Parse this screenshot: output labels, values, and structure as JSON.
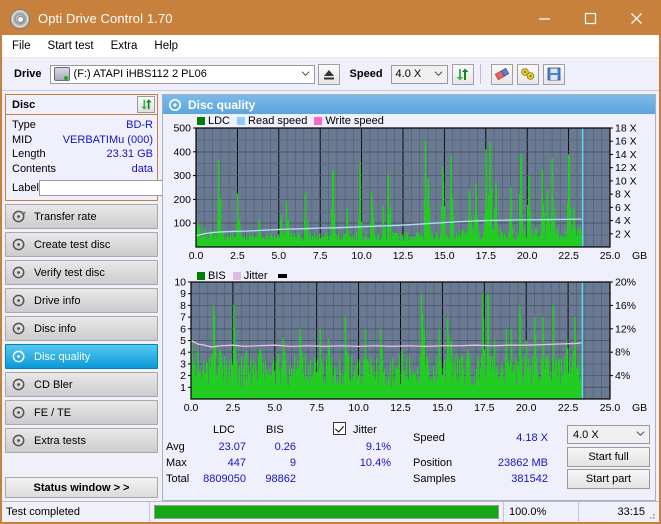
{
  "window": {
    "title": "Opti Drive Control 1.70",
    "icon": "disc-icon",
    "minimize": "minimize-icon",
    "maximize": "maximize-icon",
    "close": "close-icon",
    "accent_color": "#c8813c"
  },
  "menu": {
    "items": [
      "File",
      "Start test",
      "Extra",
      "Help"
    ]
  },
  "toolbar": {
    "drive_label": "Drive",
    "drive_value": "(F:)  ATAPI iHBS112  2 PL06",
    "eject_icon": "eject-icon",
    "speed_label": "Speed",
    "speed_value": "4.0 X",
    "refresh_icon": "refresh-icon",
    "eraser_icon": "eraser-icon",
    "config_icon": "wrench-icon",
    "save_icon": "save-icon"
  },
  "disc_panel": {
    "title": "Disc",
    "refresh_icon": "refresh-icon",
    "rows": [
      {
        "key": "Type",
        "value": "BD-R"
      },
      {
        "key": "MID",
        "value": "VERBATIMu (000)"
      },
      {
        "key": "Length",
        "value": "23.31 GB"
      },
      {
        "key": "Contents",
        "value": "data"
      }
    ],
    "label_key": "Label",
    "label_value": "",
    "label_placeholder": "",
    "label_button_icon": "cd-icon"
  },
  "sidebar": {
    "items": [
      {
        "label": "Transfer rate",
        "icon": "disc-rate-icon",
        "selected": false
      },
      {
        "label": "Create test disc",
        "icon": "disc-create-icon",
        "selected": false
      },
      {
        "label": "Verify test disc",
        "icon": "disc-verify-icon",
        "selected": false
      },
      {
        "label": "Drive info",
        "icon": "disc-drive-icon",
        "selected": false
      },
      {
        "label": "Disc info",
        "icon": "disc-info-icon",
        "selected": false
      },
      {
        "label": "Disc quality",
        "icon": "disc-quality-icon",
        "selected": true
      },
      {
        "label": "CD Bler",
        "icon": "disc-bler-icon",
        "selected": false
      },
      {
        "label": "FE / TE",
        "icon": "disc-fete-icon",
        "selected": false
      },
      {
        "label": "Extra tests",
        "icon": "disc-extra-icon",
        "selected": false
      }
    ],
    "status_window_button": "Status window > >"
  },
  "panel": {
    "header_title": "Disc quality",
    "header_icon": "disc-quality-icon"
  },
  "chart_data": [
    {
      "type": "area",
      "name": "ldc-chart",
      "title": "",
      "xlabel": "GB",
      "ylabel": "",
      "xlim": [
        0.0,
        25.0
      ],
      "ylim": [
        0,
        500
      ],
      "xticks": [
        "0.0",
        "2.5",
        "5.0",
        "7.5",
        "10.0",
        "12.5",
        "15.0",
        "17.5",
        "20.0",
        "22.5",
        "25.0"
      ],
      "yticks": [
        "100",
        "200",
        "300",
        "400",
        "500"
      ],
      "y2ticks": [
        "2 X",
        "4 X",
        "6 X",
        "8 X",
        "10 X",
        "12 X",
        "14 X",
        "16 X",
        "18 X"
      ],
      "y2lim": [
        0,
        18
      ],
      "grid": true,
      "legend": [
        {
          "label": "LDC",
          "color": "#008000"
        },
        {
          "label": "Read speed",
          "color": "#87cefa"
        },
        {
          "label": "Write speed",
          "color": "#ff66cc"
        }
      ],
      "series": [
        {
          "name": "LDC",
          "color": "#22cc22",
          "x_end_gb": 23.35,
          "baseline": [
            60,
            62,
            58,
            55,
            53,
            52,
            50,
            48,
            47,
            46,
            45,
            46,
            44,
            43,
            45,
            44,
            42,
            43,
            44,
            45,
            46,
            44,
            43,
            45,
            46,
            44,
            45,
            43,
            42,
            44,
            45,
            46,
            44,
            45,
            46,
            45,
            44,
            46,
            47,
            45,
            44,
            46,
            45,
            47,
            46,
            45,
            44,
            46,
            48,
            47,
            46,
            45,
            47,
            46,
            48,
            47,
            49,
            48,
            47,
            49,
            50,
            48,
            49,
            51,
            50,
            52,
            51,
            50,
            52,
            53,
            52,
            54,
            53,
            52,
            54,
            55,
            54,
            56,
            55,
            54,
            56,
            57,
            56,
            58,
            57,
            56,
            58,
            59,
            58,
            60,
            59,
            58,
            60,
            61,
            60,
            62,
            61,
            63,
            62,
            61
          ],
          "spikes": [
            {
              "x": 0.1,
              "y": 105
            },
            {
              "x": 1.35,
              "y": 370
            },
            {
              "x": 2.5,
              "y": 225
            },
            {
              "x": 2.55,
              "y": 120
            },
            {
              "x": 3.8,
              "y": 118
            },
            {
              "x": 5.1,
              "y": 135
            },
            {
              "x": 5.45,
              "y": 195
            },
            {
              "x": 6.6,
              "y": 230
            },
            {
              "x": 8.25,
              "y": 325
            },
            {
              "x": 9.1,
              "y": 168
            },
            {
              "x": 9.9,
              "y": 355
            },
            {
              "x": 10.6,
              "y": 232
            },
            {
              "x": 11.3,
              "y": 172
            },
            {
              "x": 11.6,
              "y": 305
            },
            {
              "x": 13.85,
              "y": 447
            },
            {
              "x": 14.0,
              "y": 290
            },
            {
              "x": 14.9,
              "y": 340
            },
            {
              "x": 15.4,
              "y": 385
            },
            {
              "x": 16.5,
              "y": 240
            },
            {
              "x": 16.9,
              "y": 270
            },
            {
              "x": 17.5,
              "y": 410
            },
            {
              "x": 17.75,
              "y": 443
            },
            {
              "x": 18.1,
              "y": 275
            },
            {
              "x": 19.0,
              "y": 250
            },
            {
              "x": 19.6,
              "y": 390
            },
            {
              "x": 20.1,
              "y": 300
            },
            {
              "x": 20.9,
              "y": 325
            },
            {
              "x": 21.2,
              "y": 240
            },
            {
              "x": 21.5,
              "y": 373
            },
            {
              "x": 22.5,
              "y": 390
            },
            {
              "x": 22.8,
              "y": 170
            }
          ]
        },
        {
          "name": "Read speed",
          "color": "#b0e0f8",
          "points_x": [
            0.0,
            0.5,
            1.0,
            1.6,
            2.2,
            3.0,
            3.8,
            4.6,
            5.4,
            6.4,
            7.4,
            8.4,
            9.4,
            10.4,
            11.4,
            12.4,
            13.4,
            14.4,
            15.4,
            16.4,
            17.4,
            18.4,
            19.4,
            20.4,
            21.4,
            22.4,
            23.3
          ],
          "points_y_speed": [
            1.7,
            2.0,
            2.2,
            2.3,
            2.35,
            2.4,
            2.5,
            2.6,
            2.7,
            2.75,
            2.85,
            2.9,
            3.0,
            3.1,
            3.2,
            3.3,
            3.45,
            3.6,
            3.75,
            3.9,
            4.0,
            4.05,
            4.1,
            4.12,
            4.15,
            4.18,
            4.2
          ]
        }
      ],
      "cursor_x_gb": 23.35
    },
    {
      "type": "area",
      "name": "bis-chart",
      "title": "",
      "xlabel": "GB",
      "ylabel": "",
      "xlim": [
        0.0,
        25.0
      ],
      "ylim": [
        0,
        10
      ],
      "xticks": [
        "0.0",
        "2.5",
        "5.0",
        "7.5",
        "10.0",
        "12.5",
        "15.0",
        "17.5",
        "20.0",
        "22.5",
        "25.0"
      ],
      "yticks": [
        "1",
        "2",
        "3",
        "4",
        "5",
        "6",
        "7",
        "8",
        "9",
        "10"
      ],
      "y2ticks": [
        "4%",
        "8%",
        "12%",
        "16%",
        "20%"
      ],
      "y2lim": [
        0,
        20
      ],
      "grid": true,
      "legend": [
        {
          "label": "BIS",
          "color": "#008000"
        },
        {
          "label": "Jitter",
          "color": "#e0b8e0"
        }
      ],
      "series": [
        {
          "name": "BIS",
          "color": "#22cc22",
          "x_end_gb": 23.35,
          "baseline_max": 3.0,
          "spikes": [
            {
              "x": 0.05,
              "y": 5.0
            },
            {
              "x": 0.4,
              "y": 4.2
            },
            {
              "x": 1.35,
              "y": 8.0
            },
            {
              "x": 1.7,
              "y": 4.2
            },
            {
              "x": 2.55,
              "y": 8.0
            },
            {
              "x": 2.6,
              "y": 5.0
            },
            {
              "x": 3.3,
              "y": 4.1
            },
            {
              "x": 4.1,
              "y": 4.3
            },
            {
              "x": 5.5,
              "y": 5.2
            },
            {
              "x": 5.6,
              "y": 4.0
            },
            {
              "x": 6.5,
              "y": 6.0
            },
            {
              "x": 6.6,
              "y": 4.1
            },
            {
              "x": 7.7,
              "y": 6.0
            },
            {
              "x": 8.2,
              "y": 5.1
            },
            {
              "x": 9.2,
              "y": 7.0
            },
            {
              "x": 9.3,
              "y": 4.2
            },
            {
              "x": 10.4,
              "y": 6.0
            },
            {
              "x": 11.3,
              "y": 6.0
            },
            {
              "x": 11.4,
              "y": 4.3
            },
            {
              "x": 12.6,
              "y": 4.2
            },
            {
              "x": 13.75,
              "y": 9.0
            },
            {
              "x": 13.9,
              "y": 6.0
            },
            {
              "x": 14.8,
              "y": 6.0
            },
            {
              "x": 15.3,
              "y": 7.0
            },
            {
              "x": 15.5,
              "y": 5.0
            },
            {
              "x": 16.5,
              "y": 4.2
            },
            {
              "x": 17.4,
              "y": 9.0
            },
            {
              "x": 17.7,
              "y": 9.0
            },
            {
              "x": 18.1,
              "y": 5.0
            },
            {
              "x": 18.8,
              "y": 6.0
            },
            {
              "x": 19.1,
              "y": 6.0
            },
            {
              "x": 19.6,
              "y": 8.0
            },
            {
              "x": 20.0,
              "y": 5.0
            },
            {
              "x": 20.5,
              "y": 7.0
            },
            {
              "x": 21.0,
              "y": 7.0
            },
            {
              "x": 21.6,
              "y": 8.0
            },
            {
              "x": 22.4,
              "y": 5.0
            },
            {
              "x": 22.9,
              "y": 7.0
            }
          ]
        },
        {
          "name": "Jitter",
          "color": "#e8c0e8",
          "points_x": [
            0.0,
            0.4,
            0.8,
            1.2,
            1.8,
            2.5,
            3.2,
            4.0,
            5.0,
            6.0,
            7.0,
            8.0,
            9.0,
            10.0,
            11.0,
            12.0,
            13.0,
            14.0,
            15.0,
            16.0,
            17.0,
            18.0,
            19.0,
            20.0,
            21.0,
            22.0,
            23.0,
            23.3
          ],
          "points_y_pct": [
            10.0,
            9.4,
            9.2,
            8.9,
            9.1,
            9.2,
            9.0,
            9.1,
            9.2,
            9.0,
            9.1,
            9.0,
            9.1,
            9.0,
            9.1,
            9.0,
            9.1,
            9.0,
            9.1,
            9.1,
            9.2,
            9.1,
            9.2,
            9.2,
            9.3,
            9.4,
            9.5,
            9.6
          ]
        }
      ],
      "cursor_x_gb": 23.35
    }
  ],
  "stats": {
    "col_headers": [
      "LDC",
      "BIS"
    ],
    "row_labels": [
      "Avg",
      "Max",
      "Total"
    ],
    "ldc": {
      "avg": "23.07",
      "max": "447",
      "total": "8809050"
    },
    "bis": {
      "avg": "0.26",
      "max": "9",
      "total": "98862"
    },
    "jitter": {
      "checkbox_label": "Jitter",
      "checked": true,
      "avg": "9.1%",
      "max": "10.4%"
    },
    "speed_label": "Speed",
    "speed_value": "4.18 X",
    "position_label": "Position",
    "position_value": "23862 MB",
    "samples_label": "Samples",
    "samples_value": "381542",
    "speed_select": "4.0 X",
    "start_full": "Start full",
    "start_part": "Start part"
  },
  "statusbar": {
    "message": "Test completed",
    "progress_percent": 100.0,
    "progress_text": "100.0%",
    "elapsed": "33:15",
    "progress_color": "#15a615"
  }
}
